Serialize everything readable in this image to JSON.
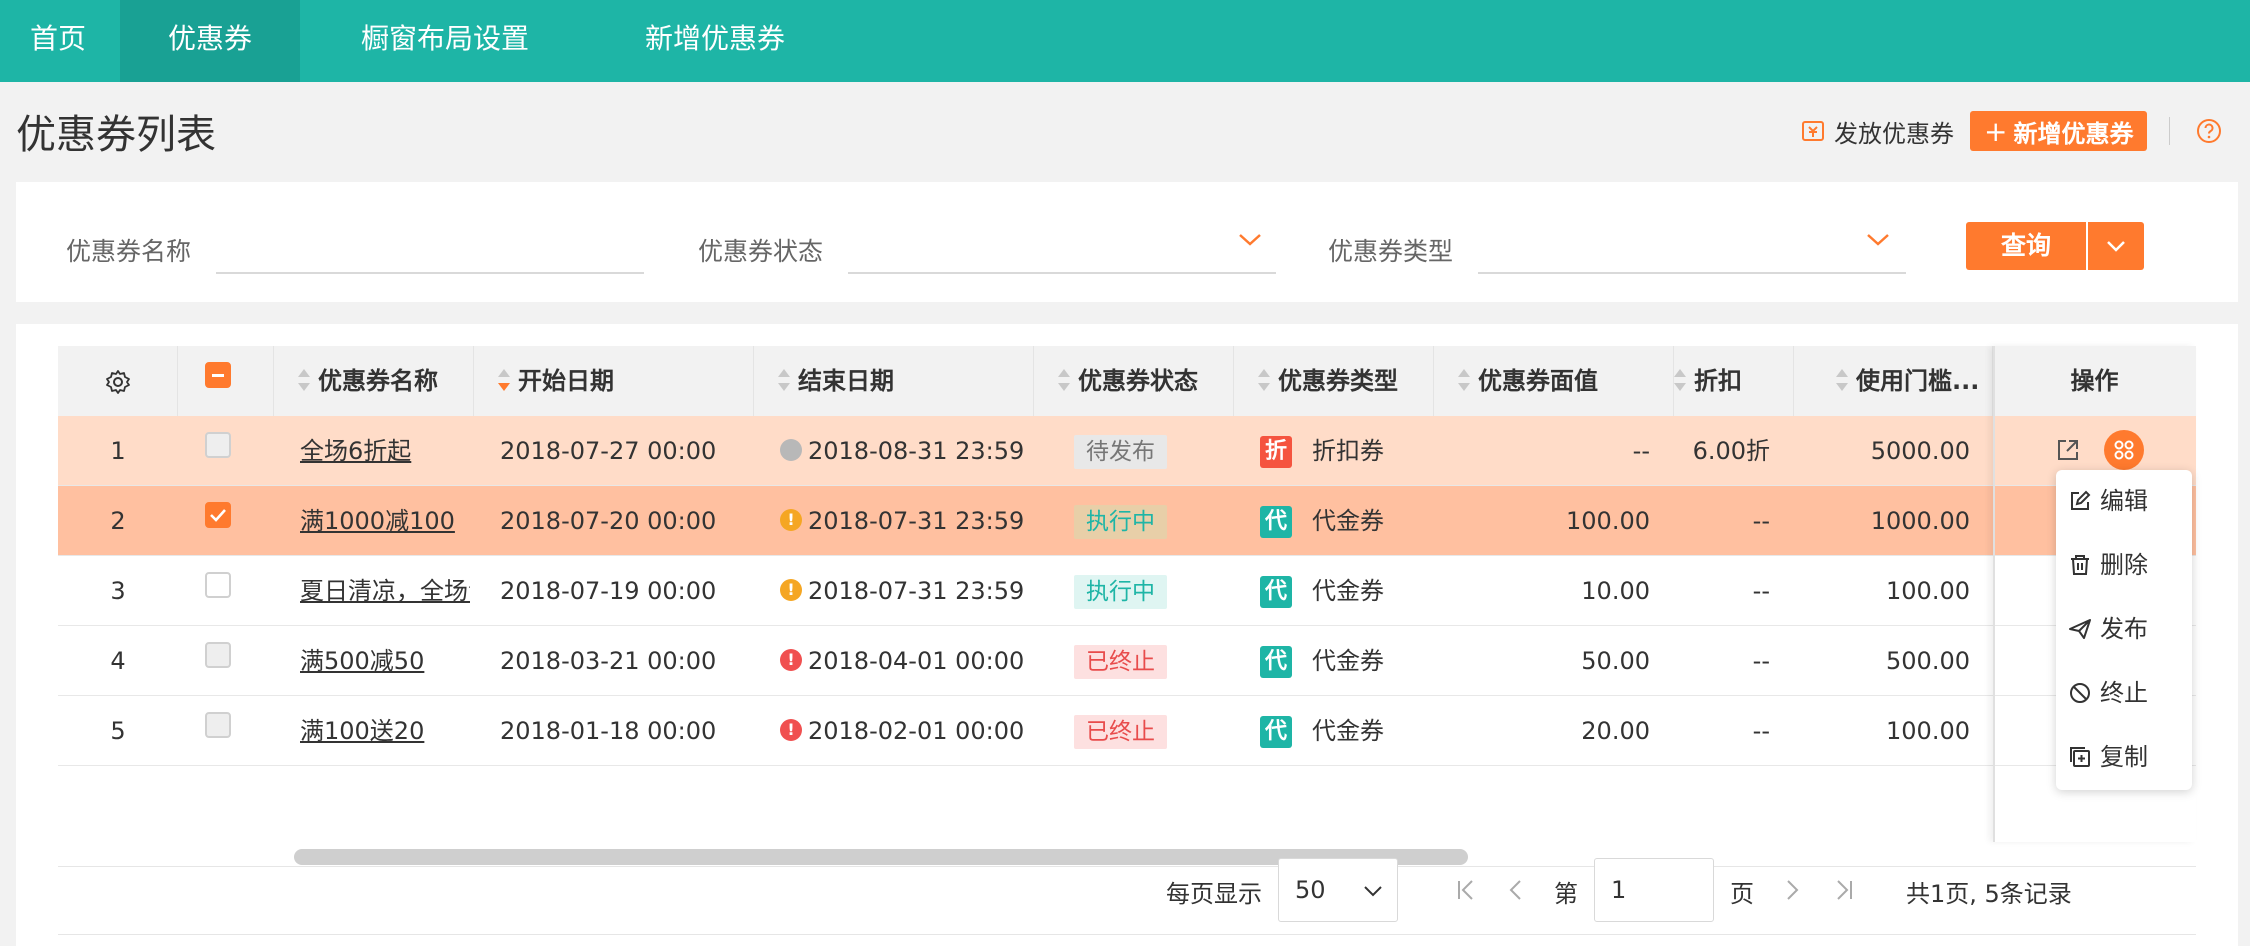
{
  "nav": {
    "tabs": [
      {
        "label": "首页"
      },
      {
        "label": "优惠券"
      },
      {
        "label": "橱窗布局设置"
      },
      {
        "label": "新增优惠券"
      }
    ],
    "active_tab": "优惠券"
  },
  "header": {
    "title": "优惠券列表",
    "issue_label": "发放优惠券",
    "add_label": "新增优惠券",
    "add_plus": "+"
  },
  "filters": {
    "name_label": "优惠券名称",
    "name_value": "",
    "status_label": "优惠券状态",
    "status_value": "",
    "type_label": "优惠券类型",
    "type_value": "",
    "query_label": "查询"
  },
  "table": {
    "columns": [
      "优惠券名称",
      "开始日期",
      "结束日期",
      "优惠券状态",
      "优惠券类型",
      "优惠券面值",
      "折扣",
      "使用门槛...",
      "操作"
    ],
    "sorted_column": "开始日期",
    "sort_direction": "desc",
    "rows": [
      {
        "index": "1",
        "checked": false,
        "name": "全场6折起",
        "start": "2018-07-27 00:00",
        "end": "2018-08-31 23:59",
        "end_state": "pending",
        "status": "待发布",
        "type_badge": "折",
        "type": "折扣券",
        "face_value": "--",
        "discount": "6.00折",
        "threshold": "5000.00"
      },
      {
        "index": "2",
        "checked": true,
        "name": "满1000减100",
        "start": "2018-07-20 00:00",
        "end": "2018-07-31 23:59",
        "end_state": "warning",
        "status": "执行中",
        "type_badge": "代",
        "type": "代金券",
        "face_value": "100.00",
        "discount": "--",
        "threshold": "1000.00"
      },
      {
        "index": "3",
        "checked": false,
        "name": "夏日清凉，全场包",
        "start": "2018-07-19 00:00",
        "end": "2018-07-31 23:59",
        "end_state": "warning",
        "status": "执行中",
        "type_badge": "代",
        "type": "代金券",
        "face_value": "10.00",
        "discount": "--",
        "threshold": "100.00"
      },
      {
        "index": "4",
        "checked": false,
        "name": "满500减50",
        "start": "2018-03-21 00:00",
        "end": "2018-04-01 00:00",
        "end_state": "expired",
        "status": "已终止",
        "type_badge": "代",
        "type": "代金券",
        "face_value": "50.00",
        "discount": "--",
        "threshold": "500.00"
      },
      {
        "index": "5",
        "checked": false,
        "name": "满100送20",
        "start": "2018-01-18 00:00",
        "end": "2018-02-01 00:00",
        "end_state": "expired",
        "status": "已终止",
        "type_badge": "代",
        "type": "代金券",
        "face_value": "20.00",
        "discount": "--",
        "threshold": "100.00"
      }
    ],
    "header_checkbox": "indeterminate"
  },
  "row_menu": {
    "items": [
      {
        "label": "编辑",
        "icon": "edit-icon"
      },
      {
        "label": "删除",
        "icon": "trash-icon"
      },
      {
        "label": "发布",
        "icon": "send-icon"
      },
      {
        "label": "终止",
        "icon": "ban-icon"
      },
      {
        "label": "复制",
        "icon": "copy-icon"
      }
    ]
  },
  "pagination": {
    "per_page_label": "每页显示",
    "per_page_value": "50",
    "page_prefix": "第",
    "page_value": "1",
    "page_suffix": "页",
    "summary": "共1页, 5条记录"
  },
  "colors": {
    "nav": "#1eb5a6",
    "accent": "#ff7a2e",
    "selected_row": "#ffc0a0",
    "highlight_row": "#ffdcc8"
  }
}
